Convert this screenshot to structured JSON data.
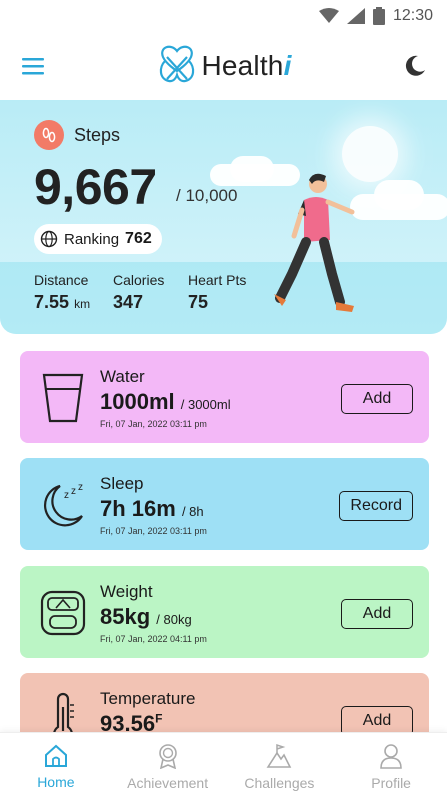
{
  "status_bar": {
    "time": "12:30",
    "icons": [
      "wifi-icon",
      "signal-icon",
      "battery-icon"
    ]
  },
  "header": {
    "brand": "Health",
    "brand_suffix": "i",
    "menu_icon": "menu-icon",
    "theme_icon": "moon-icon"
  },
  "steps": {
    "title": "Steps",
    "value": "9,667",
    "goal": "/ 10,000",
    "ranking_label": "Ranking",
    "ranking_value": "762",
    "stats": [
      {
        "label": "Distance",
        "value": "7.55",
        "unit": "km"
      },
      {
        "label": "Calories",
        "value": "347",
        "unit": ""
      },
      {
        "label": "Heart Pts",
        "value": "75",
        "unit": ""
      }
    ]
  },
  "cards": {
    "water": {
      "title": "Water",
      "amount": "1000ml",
      "goal": "/ 3000ml",
      "date": "Fri, 07 Jan, 2022 03:11 pm",
      "action": "Add"
    },
    "sleep": {
      "title": "Sleep",
      "amount": "7h 16m",
      "goal": "/ 8h",
      "date": "Fri, 07 Jan, 2022 03:11 pm",
      "action": "Record"
    },
    "weight": {
      "title": "Weight",
      "amount": "85kg",
      "goal": "/ 80kg",
      "date": "Fri, 07 Jan, 2022 04:11 pm",
      "action": "Add"
    },
    "temperature": {
      "title": "Temperature",
      "amount": "93.56",
      "unit": "F",
      "action": "Add"
    }
  },
  "nav": [
    {
      "label": "Home",
      "active": true
    },
    {
      "label": "Achievement",
      "active": false
    },
    {
      "label": "Challenges",
      "active": false
    },
    {
      "label": "Profile",
      "active": false
    }
  ],
  "colors": {
    "accent": "#2aa7d8",
    "water": "#f3b8f7",
    "sleep": "#9ee0f5",
    "weight": "#bbf5c5",
    "temperature": "#f2c3b4",
    "steps_badge": "#f27b67"
  }
}
